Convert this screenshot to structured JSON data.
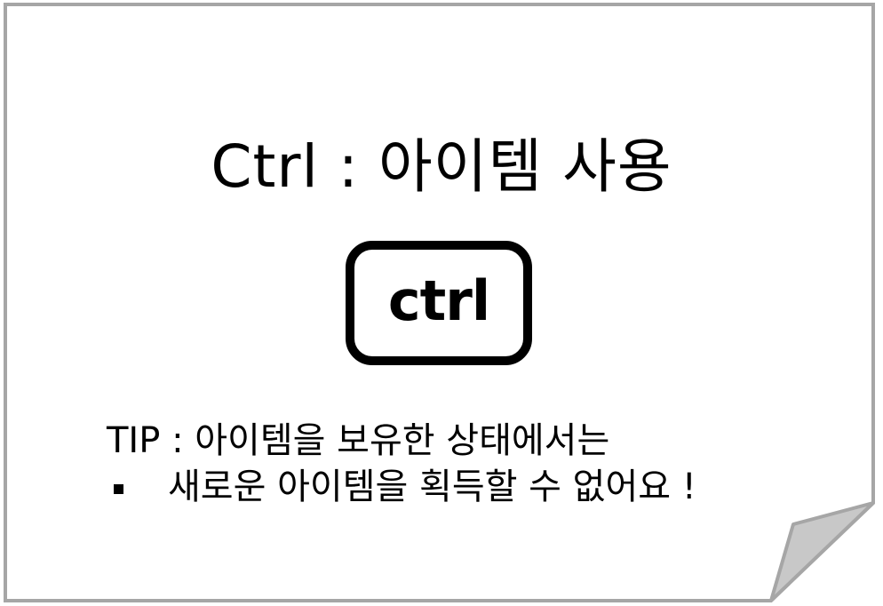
{
  "title": "Ctrl : 아이템 사용",
  "key": {
    "label": "ctrl"
  },
  "tip": {
    "line1": "TIP : 아이템을 보유한 상태에서는",
    "line2": "새로운 아이템을 획득할 수 없어요 !"
  },
  "colors": {
    "border": "#a6a6a6",
    "fold": "#c8c8c8",
    "text": "#000000",
    "background": "#ffffff"
  }
}
